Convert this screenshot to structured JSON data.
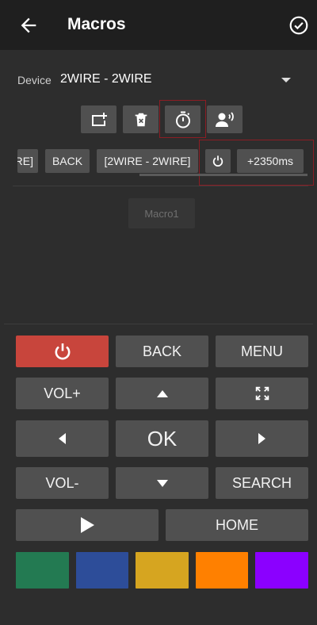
{
  "appbar": {
    "title": "Macros",
    "back_icon": "arrow-left-icon",
    "confirm_icon": "check-circle-icon"
  },
  "device": {
    "label": "Device",
    "value": "2WIRE - 2WIRE"
  },
  "toolbar": {
    "icons": [
      "add-to-queue-icon",
      "delete-icon",
      "timer-icon",
      "voice-icon"
    ]
  },
  "sequence": {
    "items": [
      {
        "label": "RE]"
      },
      {
        "label": "BACK"
      },
      {
        "label": "[2WIRE - 2WIRE]"
      },
      {
        "label": "",
        "icon": "power-icon"
      },
      {
        "label": "+2350ms"
      }
    ]
  },
  "macros": [
    {
      "label": "Macro1"
    }
  ],
  "remote": {
    "back": "BACK",
    "menu": "MENU",
    "vol_up": "VOL+",
    "ok": "OK",
    "vol_down": "VOL-",
    "search": "SEARCH",
    "home": "HOME"
  },
  "colors": {
    "accent_power": "#c8453c",
    "highlight": "#8c1d24",
    "swatches": [
      "#237a52",
      "#2d4d99",
      "#d6a520",
      "#ff8000",
      "#8b00ff"
    ]
  }
}
